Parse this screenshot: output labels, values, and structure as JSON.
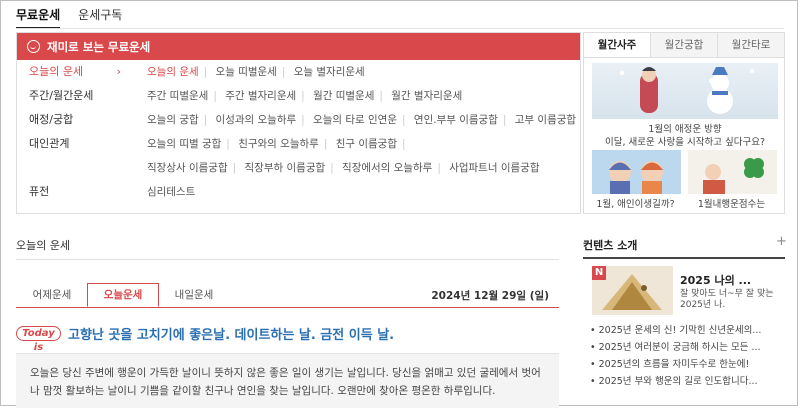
{
  "top_tabs": [
    {
      "label": "무료운세",
      "active": true
    },
    {
      "label": "운세구독",
      "active": false
    }
  ],
  "panel": {
    "header": "재미로 보는 무료운세",
    "icon": "smile-icon",
    "accent": "#d9484a",
    "categories": [
      "오늘의 운세",
      "주간/월간운세",
      "애정/궁합",
      "대인관계",
      "퓨전"
    ],
    "active_category": "오늘의 운세",
    "link_rows": [
      [
        "오늘의 운세",
        "오늘 띠별운세",
        "오늘 별자리운세"
      ],
      [
        "주간 띠별운세",
        "주간 별자리운세",
        "월간 띠별운세",
        "월간 별자리운세"
      ],
      [
        "오늘의 궁합",
        "이성과의 오늘하루",
        "오늘의 타로 인연운",
        "연인.부부 이름궁합",
        "고부 이름궁합"
      ],
      [
        "오늘의 띠별 궁합",
        "친구와의 오늘하루",
        "친구 이름궁합"
      ],
      [
        "직장상사 이름궁합",
        "직장부하 이름궁합",
        "직장에서의 오늘하루",
        "사업파트너 이름궁합"
      ],
      [
        "심리테스트"
      ]
    ]
  },
  "side": {
    "tabs": [
      "월간사주",
      "월간궁합",
      "월간타로"
    ],
    "active_tab": "월간사주",
    "hero_caption_line1": "1월의 애정운 방향",
    "hero_caption_line2": "이달, 새로운 사랑을 시작하고 싶다구요?",
    "thumb_captions": [
      "1월, 애인이생길까?",
      "1월내행운점수는"
    ]
  },
  "fortune": {
    "section_title": "오늘의 운세",
    "day_tabs": [
      "어제운세",
      "오늘운세",
      "내일운세"
    ],
    "active_day": "오늘운세",
    "date": "2024년 12월 29일 (일)",
    "badge": "Today is",
    "headline": "고향난 곳을 고치기에 좋은날. 데이트하는 날. 금전 이득 날.",
    "body_line1": "오늘은 당신 주변에 행운이 가득한 날이니 뜻하지 않은 좋은 일이 생기는 날입니다. 당신을 얽매고 있던 굴레에서 벗어",
    "body_line2": "나 맘껏 활보하는 날이니 기쁨을 같이할 친구나 연인을 찾는 날입니다. 오랜만에 찾아온 평온한 하루입니다."
  },
  "contents": {
    "title": "컨텐츠 소개",
    "badge": "N",
    "main_title": "2025 나의 ...",
    "main_desc": "잘 맞아도 너~무 잘 맞는 2025년 나.",
    "items": [
      "2025년 운세의 신! 기막힌 신년운세의...",
      "2025년 여러분이 궁금해 하시는 모든 ...",
      "2025년의 흐름을 자미두수로 한눈에!",
      "2025년 부와 행운의 길로 인도합니다..."
    ]
  }
}
